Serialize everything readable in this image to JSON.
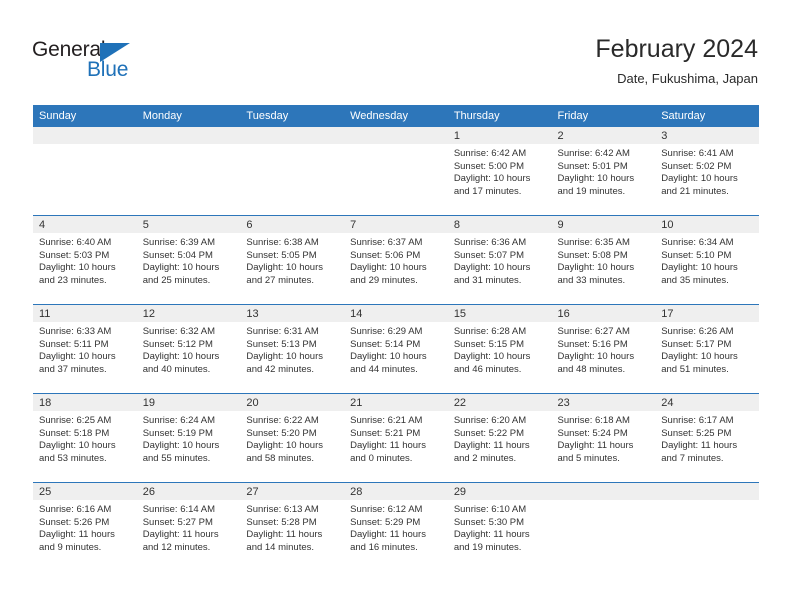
{
  "brand": {
    "name_top": "General",
    "name_bottom": "Blue",
    "accent_color": "#1f71b8"
  },
  "header": {
    "title": "February 2024",
    "subtitle": "Date, Fukushima, Japan"
  },
  "theme": {
    "header_row_bg": "#2d76ba",
    "daynum_band_bg": "#efefef",
    "grid_line": "#2d76ba",
    "text": "#333333"
  },
  "weekday_headers": [
    "Sunday",
    "Monday",
    "Tuesday",
    "Wednesday",
    "Thursday",
    "Friday",
    "Saturday"
  ],
  "weeks": [
    [
      {
        "day": "",
        "blank": true,
        "sunrise": "",
        "sunset": "",
        "daylight_1": "",
        "daylight_2": ""
      },
      {
        "day": "",
        "blank": true,
        "sunrise": "",
        "sunset": "",
        "daylight_1": "",
        "daylight_2": ""
      },
      {
        "day": "",
        "blank": true,
        "sunrise": "",
        "sunset": "",
        "daylight_1": "",
        "daylight_2": ""
      },
      {
        "day": "",
        "blank": true,
        "sunrise": "",
        "sunset": "",
        "daylight_1": "",
        "daylight_2": ""
      },
      {
        "day": "1",
        "blank": false,
        "sunrise": "Sunrise: 6:42 AM",
        "sunset": "Sunset: 5:00 PM",
        "daylight_1": "Daylight: 10 hours",
        "daylight_2": "and 17 minutes."
      },
      {
        "day": "2",
        "blank": false,
        "sunrise": "Sunrise: 6:42 AM",
        "sunset": "Sunset: 5:01 PM",
        "daylight_1": "Daylight: 10 hours",
        "daylight_2": "and 19 minutes."
      },
      {
        "day": "3",
        "blank": false,
        "sunrise": "Sunrise: 6:41 AM",
        "sunset": "Sunset: 5:02 PM",
        "daylight_1": "Daylight: 10 hours",
        "daylight_2": "and 21 minutes."
      }
    ],
    [
      {
        "day": "4",
        "blank": false,
        "sunrise": "Sunrise: 6:40 AM",
        "sunset": "Sunset: 5:03 PM",
        "daylight_1": "Daylight: 10 hours",
        "daylight_2": "and 23 minutes."
      },
      {
        "day": "5",
        "blank": false,
        "sunrise": "Sunrise: 6:39 AM",
        "sunset": "Sunset: 5:04 PM",
        "daylight_1": "Daylight: 10 hours",
        "daylight_2": "and 25 minutes."
      },
      {
        "day": "6",
        "blank": false,
        "sunrise": "Sunrise: 6:38 AM",
        "sunset": "Sunset: 5:05 PM",
        "daylight_1": "Daylight: 10 hours",
        "daylight_2": "and 27 minutes."
      },
      {
        "day": "7",
        "blank": false,
        "sunrise": "Sunrise: 6:37 AM",
        "sunset": "Sunset: 5:06 PM",
        "daylight_1": "Daylight: 10 hours",
        "daylight_2": "and 29 minutes."
      },
      {
        "day": "8",
        "blank": false,
        "sunrise": "Sunrise: 6:36 AM",
        "sunset": "Sunset: 5:07 PM",
        "daylight_1": "Daylight: 10 hours",
        "daylight_2": "and 31 minutes."
      },
      {
        "day": "9",
        "blank": false,
        "sunrise": "Sunrise: 6:35 AM",
        "sunset": "Sunset: 5:08 PM",
        "daylight_1": "Daylight: 10 hours",
        "daylight_2": "and 33 minutes."
      },
      {
        "day": "10",
        "blank": false,
        "sunrise": "Sunrise: 6:34 AM",
        "sunset": "Sunset: 5:10 PM",
        "daylight_1": "Daylight: 10 hours",
        "daylight_2": "and 35 minutes."
      }
    ],
    [
      {
        "day": "11",
        "blank": false,
        "sunrise": "Sunrise: 6:33 AM",
        "sunset": "Sunset: 5:11 PM",
        "daylight_1": "Daylight: 10 hours",
        "daylight_2": "and 37 minutes."
      },
      {
        "day": "12",
        "blank": false,
        "sunrise": "Sunrise: 6:32 AM",
        "sunset": "Sunset: 5:12 PM",
        "daylight_1": "Daylight: 10 hours",
        "daylight_2": "and 40 minutes."
      },
      {
        "day": "13",
        "blank": false,
        "sunrise": "Sunrise: 6:31 AM",
        "sunset": "Sunset: 5:13 PM",
        "daylight_1": "Daylight: 10 hours",
        "daylight_2": "and 42 minutes."
      },
      {
        "day": "14",
        "blank": false,
        "sunrise": "Sunrise: 6:29 AM",
        "sunset": "Sunset: 5:14 PM",
        "daylight_1": "Daylight: 10 hours",
        "daylight_2": "and 44 minutes."
      },
      {
        "day": "15",
        "blank": false,
        "sunrise": "Sunrise: 6:28 AM",
        "sunset": "Sunset: 5:15 PM",
        "daylight_1": "Daylight: 10 hours",
        "daylight_2": "and 46 minutes."
      },
      {
        "day": "16",
        "blank": false,
        "sunrise": "Sunrise: 6:27 AM",
        "sunset": "Sunset: 5:16 PM",
        "daylight_1": "Daylight: 10 hours",
        "daylight_2": "and 48 minutes."
      },
      {
        "day": "17",
        "blank": false,
        "sunrise": "Sunrise: 6:26 AM",
        "sunset": "Sunset: 5:17 PM",
        "daylight_1": "Daylight: 10 hours",
        "daylight_2": "and 51 minutes."
      }
    ],
    [
      {
        "day": "18",
        "blank": false,
        "sunrise": "Sunrise: 6:25 AM",
        "sunset": "Sunset: 5:18 PM",
        "daylight_1": "Daylight: 10 hours",
        "daylight_2": "and 53 minutes."
      },
      {
        "day": "19",
        "blank": false,
        "sunrise": "Sunrise: 6:24 AM",
        "sunset": "Sunset: 5:19 PM",
        "daylight_1": "Daylight: 10 hours",
        "daylight_2": "and 55 minutes."
      },
      {
        "day": "20",
        "blank": false,
        "sunrise": "Sunrise: 6:22 AM",
        "sunset": "Sunset: 5:20 PM",
        "daylight_1": "Daylight: 10 hours",
        "daylight_2": "and 58 minutes."
      },
      {
        "day": "21",
        "blank": false,
        "sunrise": "Sunrise: 6:21 AM",
        "sunset": "Sunset: 5:21 PM",
        "daylight_1": "Daylight: 11 hours",
        "daylight_2": "and 0 minutes."
      },
      {
        "day": "22",
        "blank": false,
        "sunrise": "Sunrise: 6:20 AM",
        "sunset": "Sunset: 5:22 PM",
        "daylight_1": "Daylight: 11 hours",
        "daylight_2": "and 2 minutes."
      },
      {
        "day": "23",
        "blank": false,
        "sunrise": "Sunrise: 6:18 AM",
        "sunset": "Sunset: 5:24 PM",
        "daylight_1": "Daylight: 11 hours",
        "daylight_2": "and 5 minutes."
      },
      {
        "day": "24",
        "blank": false,
        "sunrise": "Sunrise: 6:17 AM",
        "sunset": "Sunset: 5:25 PM",
        "daylight_1": "Daylight: 11 hours",
        "daylight_2": "and 7 minutes."
      }
    ],
    [
      {
        "day": "25",
        "blank": false,
        "sunrise": "Sunrise: 6:16 AM",
        "sunset": "Sunset: 5:26 PM",
        "daylight_1": "Daylight: 11 hours",
        "daylight_2": "and 9 minutes."
      },
      {
        "day": "26",
        "blank": false,
        "sunrise": "Sunrise: 6:14 AM",
        "sunset": "Sunset: 5:27 PM",
        "daylight_1": "Daylight: 11 hours",
        "daylight_2": "and 12 minutes."
      },
      {
        "day": "27",
        "blank": false,
        "sunrise": "Sunrise: 6:13 AM",
        "sunset": "Sunset: 5:28 PM",
        "daylight_1": "Daylight: 11 hours",
        "daylight_2": "and 14 minutes."
      },
      {
        "day": "28",
        "blank": false,
        "sunrise": "Sunrise: 6:12 AM",
        "sunset": "Sunset: 5:29 PM",
        "daylight_1": "Daylight: 11 hours",
        "daylight_2": "and 16 minutes."
      },
      {
        "day": "29",
        "blank": false,
        "sunrise": "Sunrise: 6:10 AM",
        "sunset": "Sunset: 5:30 PM",
        "daylight_1": "Daylight: 11 hours",
        "daylight_2": "and 19 minutes."
      },
      {
        "day": "",
        "blank": true,
        "sunrise": "",
        "sunset": "",
        "daylight_1": "",
        "daylight_2": ""
      },
      {
        "day": "",
        "blank": true,
        "sunrise": "",
        "sunset": "",
        "daylight_1": "",
        "daylight_2": ""
      }
    ]
  ]
}
